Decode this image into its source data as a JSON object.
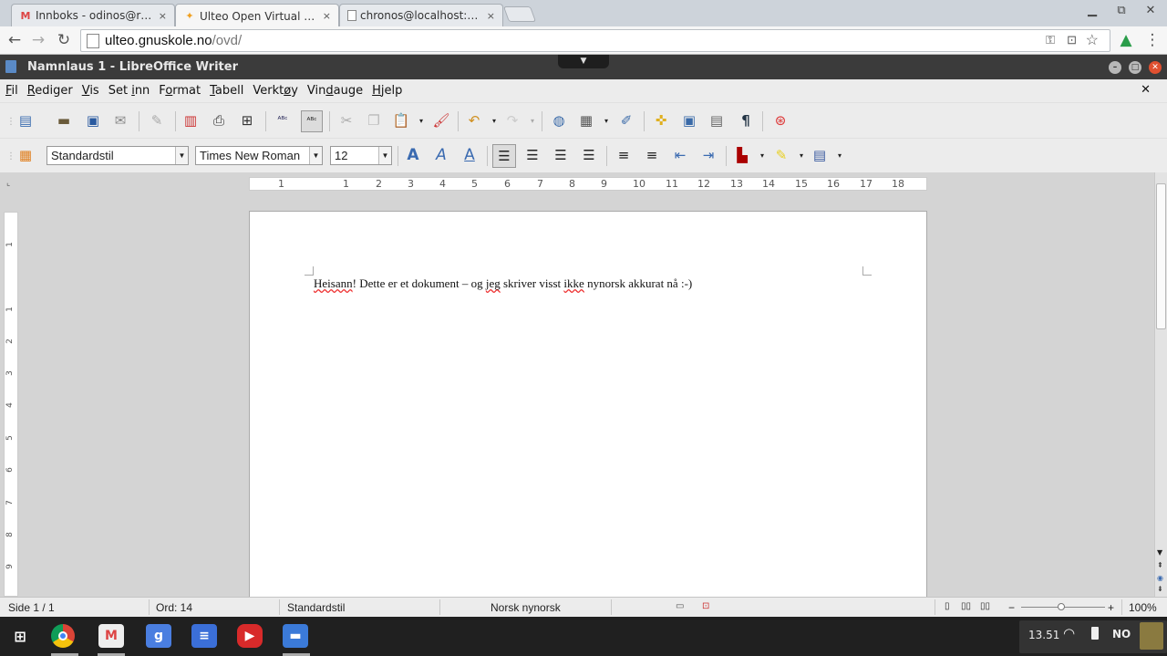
{
  "browser": {
    "tabs": [
      {
        "title": "Innboks - odinos@randal",
        "icon": "gmail-icon",
        "active": false
      },
      {
        "title": "Ulteo Open Virtual Deskt",
        "icon": "ulteo-icon",
        "active": true
      },
      {
        "title": "chronos@localhost:~/Do",
        "icon": "page-icon",
        "active": false
      }
    ],
    "close_glyph": "×",
    "url_host": "ulteo.gnuskole.no",
    "url_path": "/ovd/"
  },
  "libreoffice": {
    "window_title": "Namnlaus 1 - LibreOffice Writer",
    "menu": [
      {
        "u": "F",
        "rest": "il"
      },
      {
        "u": "R",
        "rest": "ediger"
      },
      {
        "u": "V",
        "rest": "is"
      },
      {
        "pre": "Set ",
        "u": "i",
        "rest": "nn"
      },
      {
        "pre": "F",
        "u": "o",
        "rest": "rmat"
      },
      {
        "u": "T",
        "rest": "abell"
      },
      {
        "pre": "Verkt",
        "u": "ø",
        "rest": "y"
      },
      {
        "pre": "Vin",
        "u": "d",
        "rest": "auge"
      },
      {
        "u": "H",
        "rest": "jelp"
      }
    ],
    "paragraph_style": "Standardstil",
    "font_name": "Times New Roman",
    "font_size": "12",
    "ruler_numbers": [
      "1",
      "1",
      "2",
      "3",
      "4",
      "5",
      "6",
      "7",
      "8",
      "9",
      "10",
      "11",
      "12",
      "13",
      "14",
      "15",
      "16",
      "17",
      "18"
    ],
    "vruler_numbers": [
      "1",
      "1",
      "2",
      "3",
      "4",
      "5",
      "6",
      "7",
      "8",
      "9"
    ],
    "document": {
      "w1": "Heisann",
      "t1": "! Dette er et dokument – og ",
      "w2": "jeg",
      "t2": " skriver visst ",
      "w3": "ikke",
      "t3": " nynorsk akkurat nå :-)"
    },
    "status": {
      "page": "Side 1 / 1",
      "words": "Ord: 14",
      "style": "Standardstil",
      "language": "Norsk nynorsk",
      "zoom": "100%"
    }
  },
  "shelf": {
    "time": "13.51",
    "input_method": "NO"
  },
  "colors": {
    "titlebar": "#3b3b3b",
    "shelf": "#202020",
    "accent_red": "#e33"
  }
}
